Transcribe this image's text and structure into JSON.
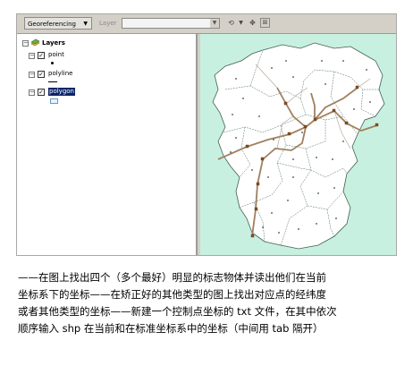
{
  "toolbar": {
    "georeferencing_label": "Georeferencing",
    "layer_label": "Layer"
  },
  "toc": {
    "root_label": "Layers",
    "layers": [
      {
        "name": "point",
        "checked": true
      },
      {
        "name": "polyline",
        "checked": true
      },
      {
        "name": "polygon",
        "checked": true,
        "selected": true
      }
    ]
  },
  "map": {
    "background_color": "#c8f0e0",
    "polygon_fill": "#ffffff",
    "road_color": "#a08060"
  },
  "caption": {
    "lines": [
      "——在图上找出四个（多个最好）明显的标志物体并读出他们在当前",
      "坐标系下的坐标——在矫正好的其他类型的图上找出对应点的经纬度",
      "或者其他类型的坐标——新建一个控制点坐标的 txt 文件，在其中依次",
      "顺序输入 shp 在当前和在标准坐标系中的坐标（中间用 tab 隔开）"
    ]
  }
}
